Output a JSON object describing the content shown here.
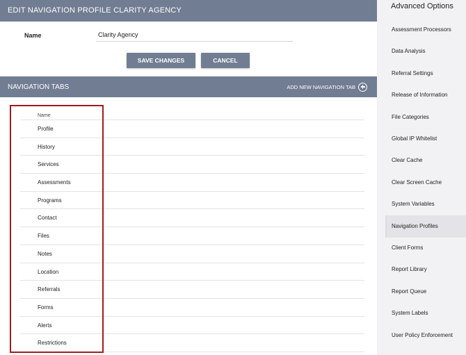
{
  "header": {
    "title": "EDIT NAVIGATION PROFILE CLARITY AGENCY"
  },
  "form": {
    "name_label": "Name",
    "name_value": "Clarity Agency"
  },
  "actions": {
    "save_label": "SAVE CHANGES",
    "cancel_label": "CANCEL"
  },
  "tabs_section": {
    "title": "NAVIGATION TABS",
    "add_label": "ADD NEW NAVIGATION TAB",
    "column_header": "Name",
    "rows": [
      "Profile",
      "History",
      "Services",
      "Assessments",
      "Programs",
      "Contact",
      "Files",
      "Notes",
      "Location",
      "Referrals",
      "Forms",
      "Alerts",
      "Restrictions"
    ]
  },
  "sidebar": {
    "title": "Advanced Options",
    "items": [
      {
        "label": "Assessment Processors",
        "active": false
      },
      {
        "label": "Data Analysis",
        "active": false
      },
      {
        "label": "Referral Settings",
        "active": false
      },
      {
        "label": "Release of Information",
        "active": false
      },
      {
        "label": "File Categories",
        "active": false
      },
      {
        "label": "Global IP Whitelist",
        "active": false
      },
      {
        "label": "Clear Cache",
        "active": false
      },
      {
        "label": "Clear Screen Cache",
        "active": false
      },
      {
        "label": "System Variables",
        "active": false
      },
      {
        "label": "Navigation Profiles",
        "active": true
      },
      {
        "label": "Client Forms",
        "active": false
      },
      {
        "label": "Report Library",
        "active": false
      },
      {
        "label": "Report Queue",
        "active": false
      },
      {
        "label": "System Labels",
        "active": false
      },
      {
        "label": "User Policy Enforcement",
        "active": false
      }
    ]
  },
  "colors": {
    "header_bar": "#717d92",
    "highlight_border": "#a01c1c",
    "sidebar_bg": "#f2f2f4"
  }
}
